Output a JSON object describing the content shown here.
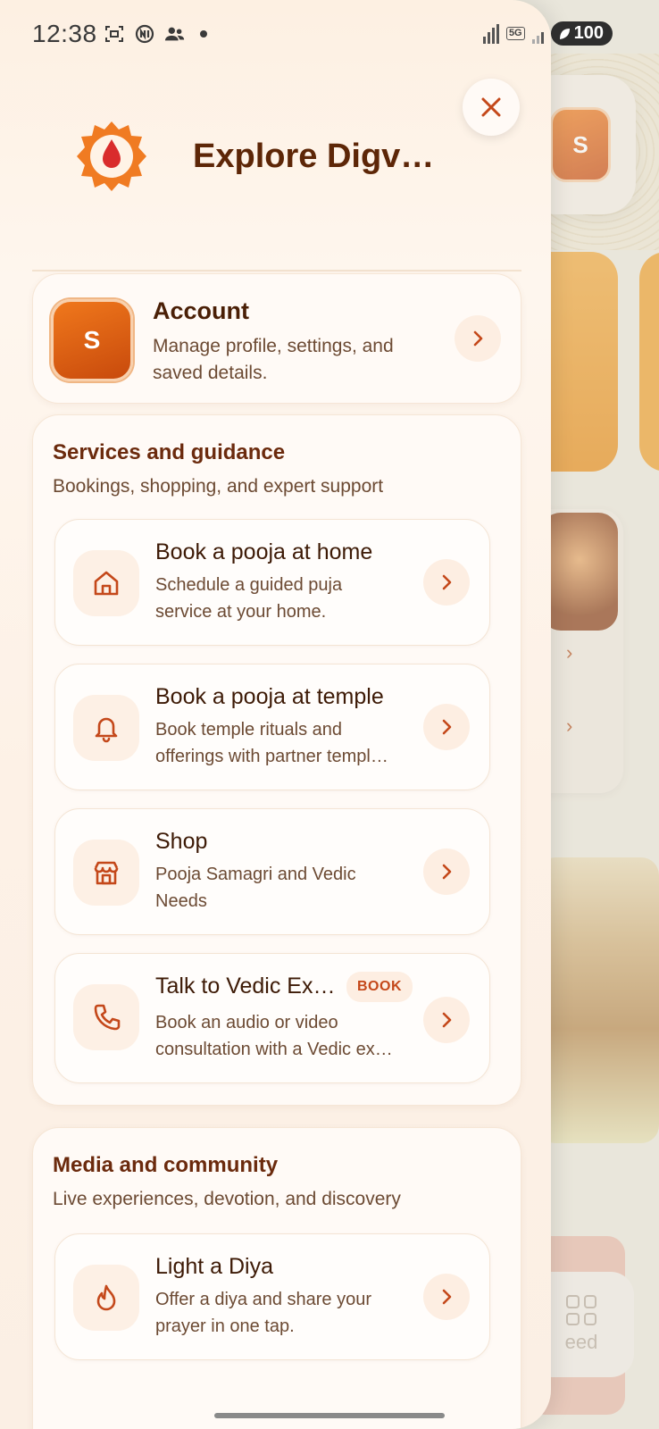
{
  "status_bar": {
    "time": "12:38",
    "network": "5G",
    "battery": "100"
  },
  "background": {
    "avatar_letter": "S",
    "feed_label": "eed"
  },
  "drawer": {
    "title": "Explore Digve…",
    "close_icon": "close-icon",
    "account": {
      "avatar_letter": "S",
      "title": "Account",
      "description": "Manage profile, settings, and saved details."
    },
    "sections": [
      {
        "title": "Services and guidance",
        "subtitle": "Bookings, shopping, and expert support",
        "items": [
          {
            "icon": "home-icon",
            "title": "Book a pooja at home",
            "desc_line1": "Schedule a guided puja",
            "desc_line2": "service at your home."
          },
          {
            "icon": "bell-icon",
            "title": "Book a pooja at temple",
            "desc_line1": "Book temple rituals and",
            "desc_line2": "offerings with partner templ…"
          },
          {
            "icon": "shop-icon",
            "title": "Shop",
            "desc_line1": "Pooja Samagri and Vedic",
            "desc_line2": "Needs"
          },
          {
            "icon": "phone-icon",
            "title": "Talk to Vedic Ex…",
            "badge": "BOOK",
            "desc_line1": "Book an audio or video",
            "desc_line2": "consultation with a Vedic ex…"
          }
        ]
      },
      {
        "title": "Media and community",
        "subtitle": "Live experiences, devotion, and discovery",
        "items": [
          {
            "icon": "flame-icon",
            "title": "Light a Diya",
            "desc_line1": "Offer a diya and share your",
            "desc_line2": "prayer in one tap."
          }
        ]
      }
    ]
  },
  "colors": {
    "accent": "#c4481a",
    "title_brown": "#5d2607",
    "drawer_bg": "#fef6ee"
  }
}
